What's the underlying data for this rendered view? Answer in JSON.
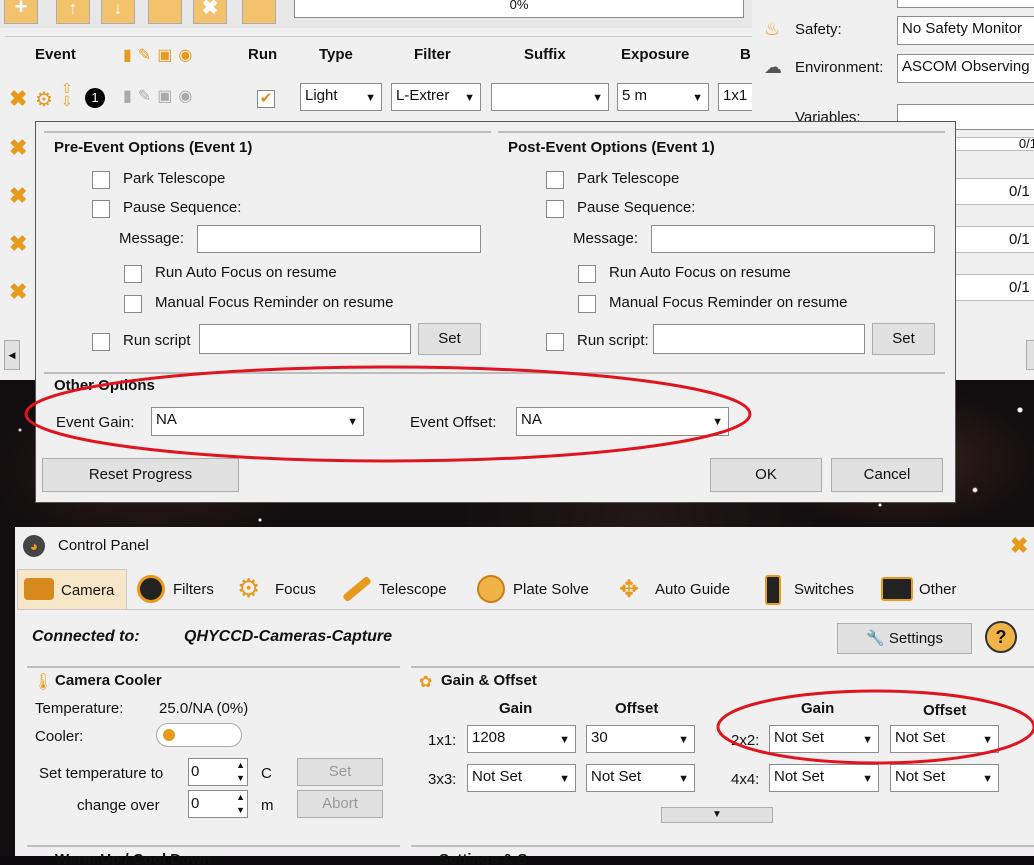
{
  "sequence": {
    "progress_text": "0%",
    "columns": [
      "Event",
      "Run",
      "Type",
      "Filter",
      "Suffix",
      "Exposure",
      "B"
    ],
    "row1": {
      "type": "Light",
      "filter": "L-Extrer",
      "suffix": "",
      "exposure": "5 m",
      "bin": "1x1"
    }
  },
  "right_panel": {
    "safety_label": "Safety:",
    "safety_value": "No Safety Monitor",
    "environment_label": "Environment:",
    "environment_value": "ASCOM Observing",
    "variables_label": "Variables:",
    "progress_values": [
      "0/1",
      "0/1 -",
      "0/1 -",
      "0/1 -"
    ]
  },
  "dialog": {
    "pre_title": "Pre-Event Options (Event 1)",
    "post_title": "Post-Event Options (Event 1)",
    "park_telescope": "Park Telescope",
    "pause_sequence": "Pause Sequence:",
    "message_label": "Message:",
    "run_auto_focus": "Run Auto Focus on resume",
    "manual_focus": "Manual Focus Reminder on resume",
    "run_script": "Run script",
    "run_script_post": "Run script:",
    "set_label": "Set",
    "other_options": "Other Options",
    "event_gain_label": "Event Gain:",
    "event_gain_value": "NA",
    "event_offset_label": "Event Offset:",
    "event_offset_value": "NA",
    "reset_progress": "Reset Progress",
    "ok": "OK",
    "cancel": "Cancel"
  },
  "control_panel": {
    "title": "Control Panel",
    "tabs": [
      "Camera",
      "Filters",
      "Focus",
      "Telescope",
      "Plate Solve",
      "Auto Guide",
      "Switches",
      "Other"
    ],
    "connected_label": "Connected to:",
    "connected_value": "QHYCCD-Cameras-Capture",
    "settings": "Settings",
    "cooler": {
      "title": "Camera Cooler",
      "temperature_label": "Temperature:",
      "temperature_value": "25.0/NA (0%)",
      "cooler_label": "Cooler:",
      "set_temp_label": "Set temperature to",
      "set_temp_value": "0",
      "set_temp_unit": "C",
      "change_over_label": "change over",
      "change_over_value": "0",
      "change_over_unit": "m",
      "set_btn": "Set",
      "abort_btn": "Abort"
    },
    "gain_offset": {
      "title": "Gain & Offset",
      "gain_header": "Gain",
      "offset_header": "Offset",
      "b1x1_label": "1x1:",
      "b1x1_gain": "1208",
      "b1x1_offset": "30",
      "b2x2_label": "2x2:",
      "b2x2_gain": "Not Set",
      "b2x2_offset": "Not Set",
      "b3x3_label": "3x3:",
      "b3x3_gain": "Not Set",
      "b3x3_offset": "Not Set",
      "b4x4_label": "4x4:",
      "b4x4_gain": "Not Set",
      "b4x4_offset": "Not Set"
    },
    "bottom_left_title": "Warm Up / Cool Down",
    "bottom_right_title": "Settings & S"
  },
  "colors": {
    "accent_orange": "#e89a1c",
    "annotation_red": "#e0141e",
    "panel_bg": "#f0f0f0",
    "tab_active": "#f7e7c8"
  }
}
